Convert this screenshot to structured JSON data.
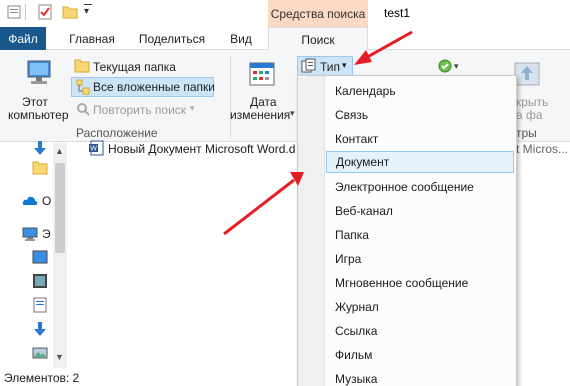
{
  "window": {
    "title": "test1",
    "context_group": "Средства поиска"
  },
  "tabs": [
    {
      "label": "Файл"
    },
    {
      "label": "Главная"
    },
    {
      "label": "Поделиться"
    },
    {
      "label": "Вид"
    },
    {
      "label": "Поиск"
    }
  ],
  "ribbon": {
    "this_pc_line1": "Этот",
    "this_pc_line2": "компьютер",
    "current_folder": "Текущая папка",
    "all_subfolders": "Все вложенные папки",
    "repeat_search": "Повторить поиск",
    "location_group": "Расположение",
    "date_modified_line1": "Дата",
    "date_modified_line2": "изменения",
    "type_button": "Тип",
    "open_location_partial": "крыть",
    "file_location_partial": "а фа",
    "filters_partial": "тры"
  },
  "content": {
    "file_name": "Новый Документ Microsoft Word.d",
    "file_type_partial": "t Micros..."
  },
  "nav": {
    "onedrive_partial": "O",
    "thispc_partial": "Э"
  },
  "status": {
    "items": "Элементов: 2"
  },
  "type_menu": {
    "items": [
      "Календарь",
      "Связь",
      "Контакт",
      "Документ",
      "Электронное сообщение",
      "Веб-канал",
      "Папка",
      "Игра",
      "Мгновенное сообщение",
      "Журнал",
      "Ссылка",
      "Фильм",
      "Музыка"
    ],
    "highlighted": "Документ"
  },
  "colors": {
    "file_tab": "#19588c",
    "context_tab": "#fbd9c5",
    "arrow": "#e51e25",
    "highlight": "#e5f1fb"
  }
}
